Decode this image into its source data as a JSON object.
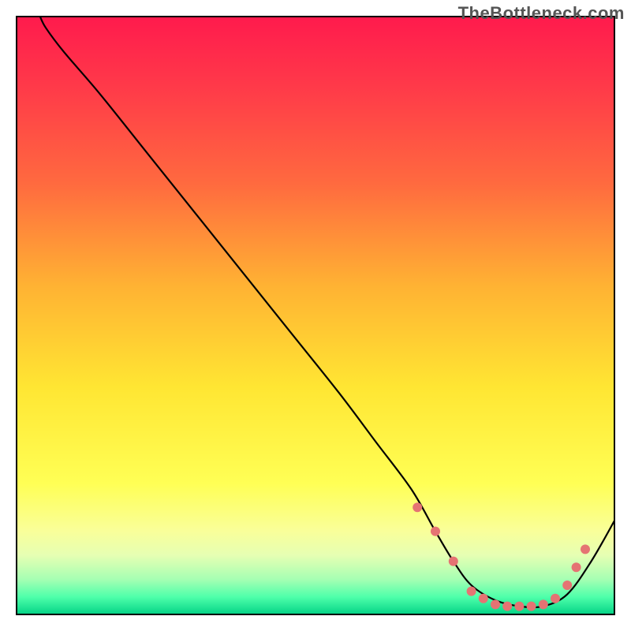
{
  "watermark": "TheBottleneck.com",
  "chart_data": {
    "type": "line",
    "title": "",
    "xlabel": "",
    "ylabel": "",
    "xlim": [
      0,
      100
    ],
    "ylim": [
      0,
      100
    ],
    "background_gradient_stops": [
      {
        "offset": 0,
        "color": "#ff1a4d"
      },
      {
        "offset": 12,
        "color": "#ff3a49"
      },
      {
        "offset": 28,
        "color": "#ff6a3f"
      },
      {
        "offset": 45,
        "color": "#ffb233"
      },
      {
        "offset": 62,
        "color": "#ffe633"
      },
      {
        "offset": 78,
        "color": "#ffff55"
      },
      {
        "offset": 86,
        "color": "#f9ff9a"
      },
      {
        "offset": 90,
        "color": "#e6ffb3"
      },
      {
        "offset": 94,
        "color": "#a6ffb3"
      },
      {
        "offset": 97,
        "color": "#4dffaa"
      },
      {
        "offset": 100,
        "color": "#00d084"
      }
    ],
    "series": [
      {
        "name": "bottleneck-curve",
        "color": "#000000",
        "stroke_width": 2.2,
        "x": [
          4,
          5,
          8,
          14,
          22,
          30,
          38,
          46,
          54,
          60,
          66,
          70,
          73,
          76,
          80,
          84,
          88,
          92,
          96,
          100
        ],
        "y": [
          100,
          98,
          94,
          87,
          77,
          67,
          57,
          47,
          37,
          29,
          21,
          14,
          9,
          5,
          2.5,
          1.5,
          1.5,
          3.5,
          9,
          16
        ]
      }
    ],
    "markers": {
      "name": "green-zone-dots",
      "color": "#e57373",
      "radius": 6,
      "points": [
        {
          "x": 67,
          "y": 18
        },
        {
          "x": 70,
          "y": 14
        },
        {
          "x": 73,
          "y": 9
        },
        {
          "x": 76,
          "y": 4
        },
        {
          "x": 78,
          "y": 2.8
        },
        {
          "x": 80,
          "y": 1.8
        },
        {
          "x": 82,
          "y": 1.5
        },
        {
          "x": 84,
          "y": 1.5
        },
        {
          "x": 86,
          "y": 1.5
        },
        {
          "x": 88,
          "y": 1.8
        },
        {
          "x": 90,
          "y": 2.8
        },
        {
          "x": 92,
          "y": 5
        },
        {
          "x": 93.5,
          "y": 8
        },
        {
          "x": 95,
          "y": 11
        }
      ]
    }
  }
}
